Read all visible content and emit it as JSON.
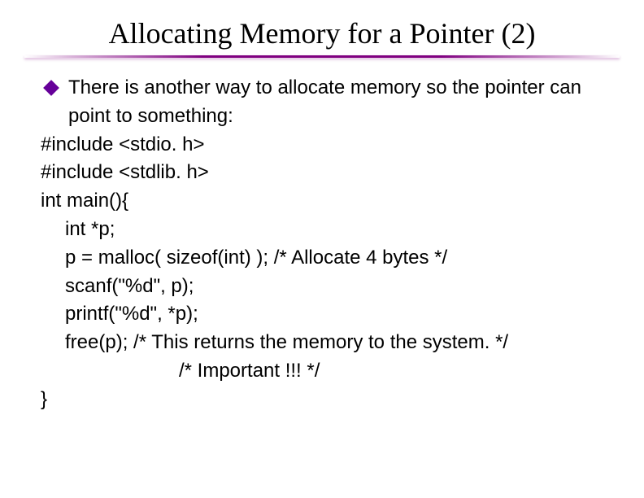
{
  "slide": {
    "title": "Allocating Memory for a Pointer (2)",
    "bullet_text": "There is another way to allocate memory so the pointer can point to something:",
    "code": {
      "line1": "#include <stdio. h>",
      "line2": "#include <stdlib. h>",
      "line3": "int main(){",
      "line4": "int *p;",
      "line5": "p = malloc( sizeof(int) );   /* Allocate 4 bytes */",
      "line6": "scanf(\"%d\", p);",
      "line7": "printf(\"%d\", *p);",
      "line8": "free(p);         /* This returns the memory to the system. */",
      "line9": "/* Important !!! */",
      "line10": "}"
    }
  }
}
